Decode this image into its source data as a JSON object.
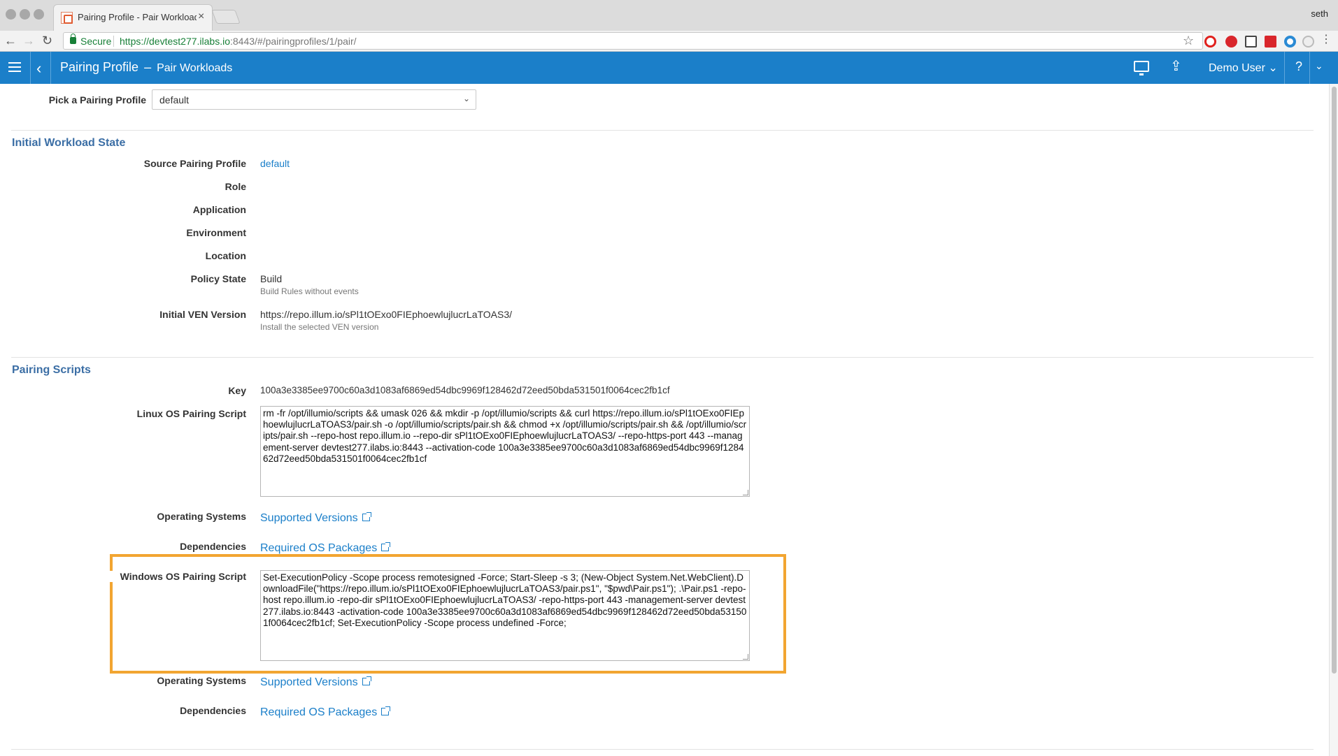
{
  "browser": {
    "tab_title": "Pairing Profile - Pair Workloads",
    "profile_name": "seth",
    "secure_label": "Secure",
    "url_host": "https://devtest277.ilabs.io",
    "url_path": ":8443/#/pairingprofiles/1/pair/"
  },
  "header": {
    "title": "Pairing Profile",
    "subtitle": "Pair Workloads",
    "user": "Demo User",
    "help": "?"
  },
  "picker": {
    "label": "Pick a Pairing Profile",
    "value": "default"
  },
  "initial_state": {
    "title": "Initial Workload State",
    "source_label": "Source Pairing Profile",
    "source_value": "default",
    "role_label": "Role",
    "application_label": "Application",
    "environment_label": "Environment",
    "location_label": "Location",
    "policy_label": "Policy State",
    "policy_value": "Build",
    "policy_sub": "Build Rules without events",
    "ven_label": "Initial VEN Version",
    "ven_value": "https://repo.illum.io/sPl1tOExo0FIEphoewlujlucrLaTOAS3/",
    "ven_sub": "Install the selected VEN version"
  },
  "pairing_scripts": {
    "title": "Pairing Scripts",
    "key_label": "Key",
    "key_value": "100a3e3385ee9700c60a3d1083af6869ed54dbc9969f128462d72eed50bda531501f0064cec2fb1cf",
    "linux_label": "Linux OS Pairing Script",
    "linux_script": "rm -fr /opt/illumio/scripts && umask 026 && mkdir -p /opt/illumio/scripts && curl https://repo.illum.io/sPl1tOExo0FIEphoewlujlucrLaTOAS3/pair.sh -o /opt/illumio/scripts/pair.sh && chmod +x /opt/illumio/scripts/pair.sh && /opt/illumio/scripts/pair.sh  --repo-host repo.illum.io --repo-dir sPl1tOExo0FIEphoewlujlucrLaTOAS3/ --repo-https-port 443  --management-server devtest277.ilabs.io:8443 --activation-code 100a3e3385ee9700c60a3d1083af6869ed54dbc9969f128462d72eed50bda531501f0064cec2fb1cf",
    "linux_os_label": "Operating Systems",
    "linux_os_link": "Supported Versions",
    "linux_dep_label": "Dependencies",
    "linux_dep_link": "Required OS Packages",
    "windows_label": "Windows OS Pairing Script",
    "windows_script": "Set-ExecutionPolicy -Scope process remotesigned -Force; Start-Sleep -s 3; (New-Object System.Net.WebClient).DownloadFile(\"https://repo.illum.io/sPl1tOExo0FIEphoewlujlucrLaTOAS3/pair.ps1\", \"$pwd\\Pair.ps1\"); .\\Pair.ps1 -repo-host repo.illum.io -repo-dir sPl1tOExo0FIEphoewlujlucrLaTOAS3/ -repo-https-port 443 -management-server devtest277.ilabs.io:8443 -activation-code 100a3e3385ee9700c60a3d1083af6869ed54dbc9969f128462d72eed50bda531501f0064cec2fb1cf; Set-ExecutionPolicy -Scope process undefined -Force;",
    "windows_os_label": "Operating Systems",
    "windows_os_link": "Supported Versions",
    "windows_dep_label": "Dependencies",
    "windows_dep_link": "Required OS Packages"
  },
  "colors": {
    "accent": "#1b7fc9",
    "section_title": "#3b6ea5",
    "highlight": "#f2a531"
  }
}
